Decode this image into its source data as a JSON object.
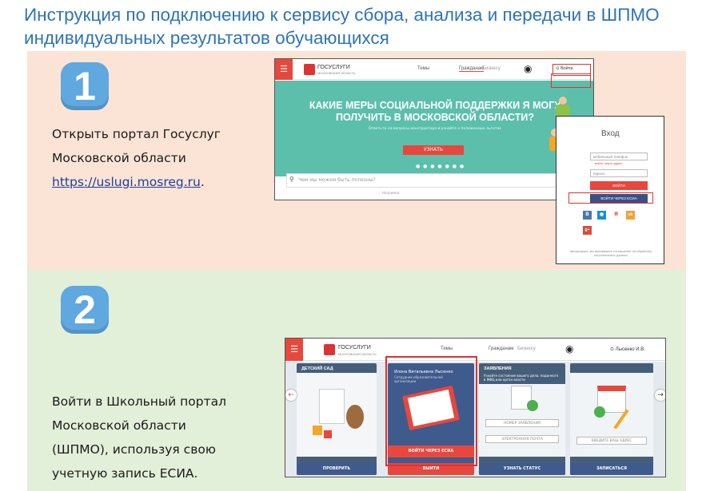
{
  "heading": "Инструкция по подключению к сервису сбора, анализа и передачи в ШПМО индивидуальных результатов обучающихся",
  "colors": {
    "heading": "#2e74b5",
    "section1_bg": "#fbe4d5",
    "section2_bg": "#e2efd9",
    "badge": "#5fa8e0",
    "accent_red": "#e8473d",
    "hero_teal": "#5bbfac"
  },
  "steps": [
    {
      "number": "1",
      "text_lines": [
        "Открыть портал Госуслуг",
        "Московской области"
      ],
      "link": "https://uslugi.mosreg.ru",
      "link_suffix": ".",
      "screenshot": {
        "logo_title": "ГОСУСЛУГИ",
        "logo_subtitle": "МОСКОВСКАЯ ОБЛАСТЬ",
        "nav_themes": "Темы",
        "nav_citizens": "Гражданам",
        "nav_business": "Бизнесу",
        "login_label": "Войти",
        "hero_title_1": "КАКИЕ МЕРЫ СОЦИАЛЬНОЙ ПОДДЕРЖКИ Я МОГУ",
        "hero_title_2": "ПОЛУЧИТЬ В МОСКОВСКОЙ ОБЛАСТИ?",
        "hero_subtitle": "Ответьте на вопросы конструктора и узнайте о положенных льготах",
        "hero_button": "УЗНАТЬ",
        "search_placeholder": "Чем мы можем быть полезны?",
        "popular_label": "Например:",
        "login_panel": {
          "title": "Вход",
          "phone_placeholder": "мобильный телефон",
          "email_link": "войти через адрес",
          "password_placeholder": "пароль",
          "submit": "ВОЙТИ",
          "esia": "ВОЙТИ ЧЕРЕЗ ЕСИА",
          "socials": [
            "В",
            "◉",
            "Я",
            "ok",
            "g+"
          ],
          "note": "авторизуясь, вы принимаете соглашение на обработку персональных данных"
        }
      }
    },
    {
      "number": "2",
      "text_lines": [
        "Войти в Школьный портал",
        "Московской области",
        "(ШПМО), используя свою",
        "учетную запись ЕСИА."
      ],
      "screenshot": {
        "logo_title": "ГОСУСЛУГИ",
        "logo_subtitle": "МОСКОВСКАЯ ОБЛАСТЬ",
        "nav_themes": "Темы",
        "nav_citizens": "Гражданам",
        "nav_business": "Бизнесу",
        "user_name": "Лысенко И.В.",
        "tiles": [
          {
            "title": "ДЕТСКИЙ САД",
            "footer": "ПРОВЕРИТЬ"
          },
          {
            "title": "",
            "person": "Илона Витальевна Лысенко",
            "role": "Сотрудник образовательной организации",
            "esia_button": "ВОЙТИ ЧЕРЕЗ ЕСИА",
            "footer": "ВЫЙТИ"
          },
          {
            "title": "ЗАЯВЛЕНИЯ",
            "desc": "Узнайте состояние вашего дела, поданного в МФЦ или орган власти",
            "field1": "НОМЕР ЗАЯВЛЕНИЯ",
            "field2": "ЭЛЕКТРОННАЯ ПОЧТА",
            "footer": "УЗНАТЬ СТАТУС"
          },
          {
            "title": "",
            "field1": "ВВЕДИТЕ ВАШ АДРЕС",
            "footer": "ЗАПИСАТЬСЯ"
          }
        ]
      }
    }
  ]
}
